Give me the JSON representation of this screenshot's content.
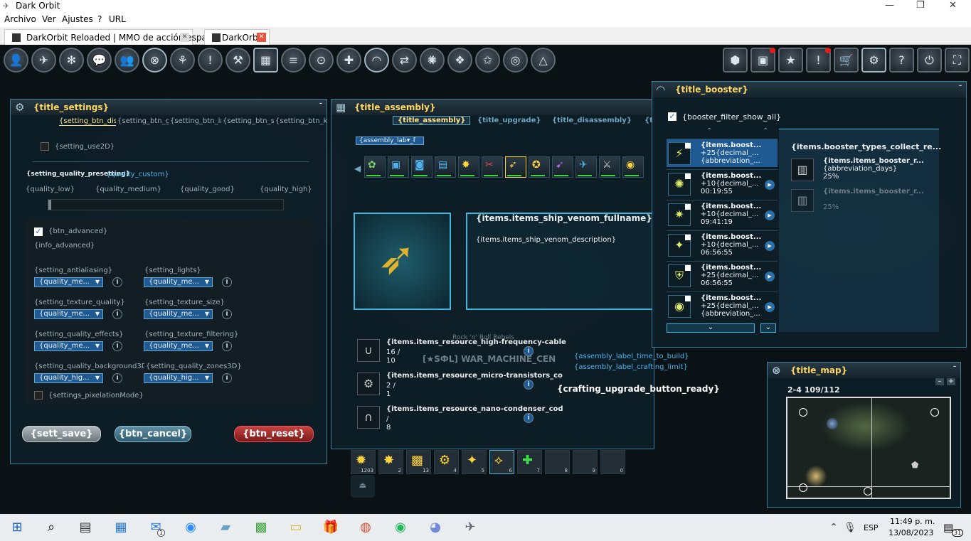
{
  "window": {
    "title": "Dark Orbit",
    "minimize": "—",
    "maximize": "❐",
    "close": "✕"
  },
  "menu": [
    "Archivo",
    "Ver",
    "Ajustes",
    "?",
    "URL"
  ],
  "tabs": [
    {
      "label": "DarkOrbit Reloaded | MMO de acción espacial",
      "close": "✕"
    },
    {
      "label": "DarkOrbit",
      "close": "✕"
    }
  ],
  "hud_left_icons": [
    {
      "icon": "pilot-icon",
      "glyph": "👤"
    },
    {
      "icon": "ship-icon",
      "glyph": "✈"
    },
    {
      "icon": "clan-icon",
      "glyph": "✻"
    },
    {
      "icon": "chat-icon",
      "glyph": "💬"
    },
    {
      "icon": "group-icon",
      "glyph": "👥"
    },
    {
      "icon": "target-icon",
      "glyph": "⊗"
    },
    {
      "icon": "drones-icon",
      "glyph": "⚘"
    },
    {
      "icon": "quests-icon",
      "glyph": "!"
    },
    {
      "icon": "tools-icon",
      "glyph": "⚒"
    },
    {
      "icon": "assembly-icon",
      "glyph": "▦"
    },
    {
      "icon": "log-icon",
      "glyph": "≡"
    },
    {
      "icon": "location-icon",
      "glyph": "⊙"
    },
    {
      "icon": "add-pet-icon",
      "glyph": "✚"
    },
    {
      "icon": "booster-icon",
      "glyph": "◠"
    },
    {
      "icon": "trade-icon",
      "glyph": "⇄"
    },
    {
      "icon": "gate-icon",
      "glyph": "✺"
    },
    {
      "icon": "faction-icon",
      "glyph": "❖"
    },
    {
      "icon": "rank-icon",
      "glyph": "✩"
    },
    {
      "icon": "mask-icon",
      "glyph": "◎"
    },
    {
      "icon": "pyramid-icon",
      "glyph": "△"
    }
  ],
  "hud_right_icons": [
    {
      "icon": "cargo-icon",
      "glyph": "⬢",
      "notify": false
    },
    {
      "icon": "events-icon",
      "glyph": "▣",
      "notify": true
    },
    {
      "icon": "star-icon",
      "glyph": "★",
      "notify": false
    },
    {
      "icon": "news-icon",
      "glyph": "!",
      "notify": true
    },
    {
      "icon": "shop-icon",
      "glyph": "🛒",
      "notify": false
    },
    {
      "icon": "settings-icon",
      "glyph": "⚙",
      "notify": false
    },
    {
      "icon": "help-icon",
      "glyph": "?",
      "notify": false
    },
    {
      "icon": "logout-icon",
      "glyph": "⏻",
      "notify": false
    },
    {
      "icon": "fullscreen-icon",
      "glyph": "⛶",
      "notify": false
    }
  ],
  "settings": {
    "title": "{title_settings}",
    "tabs": [
      "{setting_btn_displ",
      "{setting_btn_ga",
      "{setting_btn_in",
      "{setting_btn_sc",
      "{setting_btn_ke"
    ],
    "use2d": "{setting_use2D}",
    "preset": "{setting_quality_presetting}",
    "preset_value": "{quality_custom}",
    "levels": [
      "{quality_low}",
      "{quality_medium}",
      "{quality_good}",
      "{quality_high}"
    ],
    "advanced": "{btn_advanced}",
    "info_advanced": "{info_advanced}",
    "options": [
      {
        "label": "{setting_antialiasing}",
        "value": "{quality_me..."
      },
      {
        "label": "{setting_lights}",
        "value": "{quality_me..."
      },
      {
        "label": "{setting_texture_quality}",
        "value": "{quality_me..."
      },
      {
        "label": "{setting_texture_size}",
        "value": "{quality_me..."
      },
      {
        "label": "{setting_quality_effects}",
        "value": "{quality_me..."
      },
      {
        "label": "{setting_texture_filtering}",
        "value": "{quality_me..."
      },
      {
        "label": "{setting_quality_background3D}",
        "value": "{quality_hig..."
      },
      {
        "label": "{setting_quality_zones3D}",
        "value": "{quality_hig..."
      }
    ],
    "pixelation": "{settings_pixelationMode}",
    "save": "{sett_save}",
    "cancel": "{btn_cancel}",
    "reset": "{btn_reset}"
  },
  "assembly": {
    "title": "{title_assembly}",
    "tabs": [
      "{title_assembly}",
      "{title_upgrade}",
      "{title_disassembly}",
      "{ti"
    ],
    "filter": "{assembly_lab▾_f",
    "ship_name": "{items.items_ship_venom_fullname}",
    "ship_desc": "{items.items_ship_venom_description}",
    "resources": [
      {
        "name": "{items.items_resource_high-frequency-cable",
        "have": "16 /",
        "need": "10"
      },
      {
        "name": "{items.items_resource_micro-transistors_co",
        "have": "2 /",
        "need": "1"
      },
      {
        "name": "{items.items_resource_nano-condenser_cod",
        "have": " /",
        "need": "8"
      }
    ],
    "time_label": "{assembly_label_time_to_build}",
    "crafting_label": "{assembly_label_crafting_limit}",
    "upgrade_btn": "{crafting_upgrade_button_ready}",
    "bg_text": "Rock 'n' Roll Rebels",
    "bg_text2": "[★SФL] WAR_MACHINE_CEN"
  },
  "quickbar": [
    {
      "glyph": "✹",
      "count": "1203"
    },
    {
      "glyph": "✸",
      "count": "2"
    },
    {
      "glyph": "▩",
      "count": "13"
    },
    {
      "glyph": "⚙",
      "count": "4"
    },
    {
      "glyph": "✦",
      "count": "5"
    },
    {
      "glyph": "⟡",
      "count": "6"
    },
    {
      "glyph": "✚",
      "count": "7"
    },
    {
      "glyph": "",
      "count": "8"
    },
    {
      "glyph": "",
      "count": "9"
    },
    {
      "glyph": "",
      "count": "0"
    }
  ],
  "booster": {
    "title": "{title_booster}",
    "filter": "{booster_filter_show_all}",
    "items": [
      {
        "l1": "{items.boost...",
        "l2": "+25{decimal_...",
        "l3": "{abbreviation_...",
        "glyph": "⚡",
        "play": false
      },
      {
        "l1": "{items.boost...",
        "l2": "+10{decimal_...",
        "l3": "00:19:55",
        "glyph": "✺",
        "play": true
      },
      {
        "l1": "{items.boost...",
        "l2": "+10{decimal_...",
        "l3": "09:41:19",
        "glyph": "✷",
        "play": true
      },
      {
        "l1": "{items.boost...",
        "l2": "+10{decimal_...",
        "l3": "06:56:55",
        "glyph": "✦",
        "play": true
      },
      {
        "l1": "{items.boost...",
        "l2": "+25{decimal_...",
        "l3": "06:56:55",
        "glyph": "⛨",
        "play": true
      },
      {
        "l1": "{items.boost...",
        "l2": "+25{decimal_...",
        "l3": "{abbreviation_...",
        "glyph": "◉",
        "play": true
      }
    ],
    "collect": "{items.booster_types_collect_re...",
    "details": [
      {
        "name": "{items.items_booster_r...",
        "sub": "{abbreviation_days}",
        "pct": "25%"
      },
      {
        "name": "{items.items_booster_r...",
        "sub": "",
        "pct": "25%"
      }
    ]
  },
  "map": {
    "title": "{title_map}",
    "coords": "2-4 109/112"
  },
  "taskbar": {
    "lang": "ESP",
    "time": "11:49 p. m.",
    "date": "13/08/2023",
    "notif_count": "31",
    "mail_count": "1",
    "icons": [
      {
        "icon": "windows-start-icon",
        "glyph": "⊞"
      },
      {
        "icon": "search-icon",
        "glyph": "⌕"
      },
      {
        "icon": "task-view-icon",
        "glyph": "▤"
      },
      {
        "icon": "calculator-icon",
        "glyph": "▦"
      },
      {
        "icon": "mail-icon",
        "glyph": "✉"
      },
      {
        "icon": "zoom-icon",
        "glyph": "◉"
      },
      {
        "icon": "notes-icon",
        "glyph": "▰"
      },
      {
        "icon": "minecraft-icon",
        "glyph": "▩"
      },
      {
        "icon": "file-explorer-icon",
        "glyph": "▭"
      },
      {
        "icon": "gift-icon",
        "glyph": "🎁"
      },
      {
        "icon": "chrome-icon",
        "glyph": "◍"
      },
      {
        "icon": "spotify-icon",
        "glyph": "◉"
      },
      {
        "icon": "discord-icon",
        "glyph": "◕"
      },
      {
        "icon": "darkorbit-icon",
        "glyph": "✈"
      }
    ]
  }
}
